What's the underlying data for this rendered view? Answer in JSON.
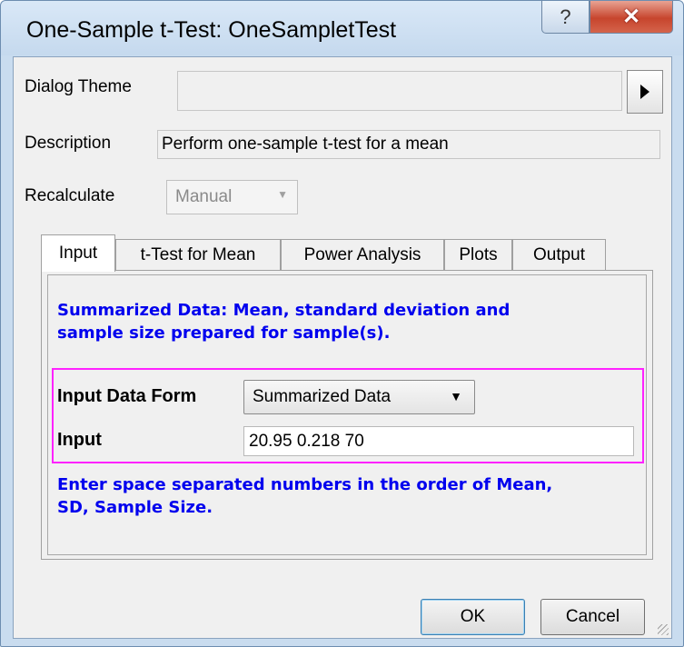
{
  "window": {
    "title": "One-Sample t-Test: OneSampletTest",
    "help_label": "?",
    "close_label": "✕"
  },
  "dialog_theme": {
    "label": "Dialog Theme",
    "value": "",
    "arrow_icon": "play-right-icon"
  },
  "description": {
    "label": "Description",
    "value": "Perform one-sample t-test for a mean"
  },
  "recalculate": {
    "label": "Recalculate",
    "value": "Manual"
  },
  "tabs": [
    {
      "label": "Input",
      "active": true
    },
    {
      "label": "t-Test for Mean",
      "active": false
    },
    {
      "label": "Power Analysis",
      "active": false
    },
    {
      "label": "Plots",
      "active": false
    },
    {
      "label": "Output",
      "active": false
    }
  ],
  "input_tab": {
    "summary_text_line1": "Summarized Data: Mean, standard deviation and",
    "summary_text_line2": "sample size prepared for sample(s).",
    "data_form_label": "Input Data Form",
    "data_form_value": "Summarized Data",
    "input_label": "Input",
    "input_value": "20.95 0.218 70",
    "hint_line1": "Enter space separated numbers in the order of Mean,",
    "hint_line2": "SD, Sample Size."
  },
  "buttons": {
    "ok": "OK",
    "cancel": "Cancel"
  },
  "colors": {
    "highlight": "#ff22ff",
    "info_text": "#0000ee"
  }
}
